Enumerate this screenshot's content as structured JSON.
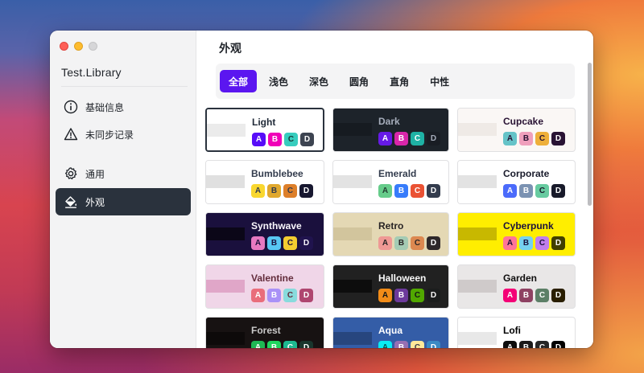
{
  "app": {
    "library_name": "Test.Library"
  },
  "sidebar": {
    "items": [
      {
        "label": "基础信息",
        "icon": "info-icon"
      },
      {
        "label": "未同步记录",
        "icon": "warning-icon"
      },
      {
        "label": "通用",
        "icon": "gear-icon"
      },
      {
        "label": "外观",
        "icon": "paint-bucket-icon"
      }
    ],
    "active_index": 3
  },
  "main": {
    "title": "外观",
    "tabs": [
      "全部",
      "浅色",
      "深色",
      "圆角",
      "直角",
      "中性"
    ],
    "active_tab": 0
  },
  "themes": [
    {
      "name": "Light",
      "bg": "#ffffff",
      "fg": "#1f2937",
      "swatch": "#ffffff",
      "band": "#ebebeb",
      "chips": [
        [
          "A",
          "#570df8",
          "#fff"
        ],
        [
          "B",
          "#f000b8",
          "#fff"
        ],
        [
          "C",
          "#37cdbe",
          "#163835"
        ],
        [
          "D",
          "#3d4451",
          "#fff"
        ]
      ]
    },
    {
      "name": "Dark",
      "bg": "#1d232a",
      "fg": "#a6adbb",
      "swatch": "#1d232a",
      "band": "#161b21",
      "chips": [
        [
          "A",
          "#661ae6",
          "#fff"
        ],
        [
          "B",
          "#d926aa",
          "#fff"
        ],
        [
          "C",
          "#1fb2a5",
          "#fff"
        ],
        [
          "D",
          "#191d24",
          "#a6adbb"
        ]
      ]
    },
    {
      "name": "Cupcake",
      "bg": "#faf7f5",
      "fg": "#291334",
      "swatch": "#faf7f5",
      "band": "#efeae6",
      "chips": [
        [
          "A",
          "#65c3c8",
          "#291334"
        ],
        [
          "B",
          "#ef9fbc",
          "#291334"
        ],
        [
          "C",
          "#eeaf3a",
          "#291334"
        ],
        [
          "D",
          "#291334",
          "#fff"
        ]
      ]
    },
    {
      "name": "Bumblebee",
      "bg": "#ffffff",
      "fg": "#333c4d",
      "swatch": "#ffffff",
      "band": "#e0e0e0",
      "chips": [
        [
          "A",
          "#f9d72f",
          "#333c4d"
        ],
        [
          "B",
          "#e0a82e",
          "#333c4d"
        ],
        [
          "C",
          "#dd7f2a",
          "#333c4d"
        ],
        [
          "D",
          "#181830",
          "#fff"
        ]
      ]
    },
    {
      "name": "Emerald",
      "bg": "#ffffff",
      "fg": "#333c4d",
      "swatch": "#ffffff",
      "band": "#e3e3e3",
      "chips": [
        [
          "A",
          "#66cc8a",
          "#223d30"
        ],
        [
          "B",
          "#377cfb",
          "#fff"
        ],
        [
          "C",
          "#ea5234",
          "#fff"
        ],
        [
          "D",
          "#333c4d",
          "#fff"
        ]
      ]
    },
    {
      "name": "Corporate",
      "bg": "#ffffff",
      "fg": "#181a2a",
      "swatch": "#ffffff",
      "band": "#e3e3e3",
      "chips": [
        [
          "A",
          "#4b6bfb",
          "#fff"
        ],
        [
          "B",
          "#7b92b2",
          "#fff"
        ],
        [
          "C",
          "#67cba0",
          "#181a2a"
        ],
        [
          "D",
          "#181a2a",
          "#fff"
        ]
      ]
    },
    {
      "name": "Synthwave",
      "bg": "#1a103d",
      "fg": "#f9f7fd",
      "swatch": "#1a103d",
      "band": "#0b0718",
      "chips": [
        [
          "A",
          "#e779c1",
          "#1a103d"
        ],
        [
          "B",
          "#58c7f3",
          "#1a103d"
        ],
        [
          "C",
          "#f3cc30",
          "#1a103d"
        ],
        [
          "D",
          "#20134e",
          "#f9f7fd"
        ]
      ]
    },
    {
      "name": "Retro",
      "bg": "#e4d8b4",
      "fg": "#282425",
      "swatch": "#e4d8b4",
      "band": "#d2c59d",
      "chips": [
        [
          "A",
          "#ef9995",
          "#282425"
        ],
        [
          "B",
          "#a4cbb4",
          "#282425"
        ],
        [
          "C",
          "#dc8850",
          "#282425"
        ],
        [
          "D",
          "#2e282a",
          "#fff"
        ]
      ]
    },
    {
      "name": "Cyberpunk",
      "bg": "#ffee00",
      "fg": "#1a103d",
      "swatch": "#ffee00",
      "band": "#c8b800",
      "chips": [
        [
          "A",
          "#ff7598",
          "#1a103d"
        ],
        [
          "B",
          "#75d1f0",
          "#1a103d"
        ],
        [
          "C",
          "#c07eec",
          "#1a103d"
        ],
        [
          "D",
          "#423f00",
          "#fff"
        ]
      ]
    },
    {
      "name": "Valentine",
      "bg": "#f0d6e8",
      "fg": "#632c3b",
      "swatch": "#f0d6e8",
      "band": "#e0a6c8",
      "chips": [
        [
          "A",
          "#e96d7b",
          "#fff"
        ],
        [
          "B",
          "#a991f7",
          "#fff"
        ],
        [
          "C",
          "#88dbdd",
          "#632c3b"
        ],
        [
          "D",
          "#af4670",
          "#fff"
        ]
      ]
    },
    {
      "name": "Halloween",
      "bg": "#212121",
      "fg": "#f8f8f8",
      "swatch": "#212121",
      "band": "#0d0d0d",
      "chips": [
        [
          "A",
          "#f28c18",
          "#131616"
        ],
        [
          "B",
          "#6d3a9c",
          "#fff"
        ],
        [
          "C",
          "#51a800",
          "#131616"
        ],
        [
          "D",
          "#1b1d1d",
          "#f8f8f8"
        ]
      ]
    },
    {
      "name": "Garden",
      "bg": "#e9e7e7",
      "fg": "#100f0f",
      "swatch": "#e9e7e7",
      "band": "#cfcaca",
      "chips": [
        [
          "A",
          "#f40076",
          "#fff"
        ],
        [
          "B",
          "#8e4162",
          "#fff"
        ],
        [
          "C",
          "#5c7f67",
          "#fff"
        ],
        [
          "D",
          "#291e00",
          "#fff"
        ]
      ]
    },
    {
      "name": "Forest",
      "bg": "#171212",
      "fg": "#cac9c9",
      "swatch": "#171212",
      "band": "#0d0a0a",
      "chips": [
        [
          "A",
          "#1eb854",
          "#fff"
        ],
        [
          "B",
          "#1fd65f",
          "#fff"
        ],
        [
          "C",
          "#1db990",
          "#fff"
        ],
        [
          "D",
          "#19362d",
          "#fff"
        ]
      ]
    },
    {
      "name": "Aqua",
      "bg": "#345da7",
      "fg": "#ffffff",
      "swatch": "#345da7",
      "band": "#27467e",
      "chips": [
        [
          "A",
          "#09ecf3",
          "#005355"
        ],
        [
          "B",
          "#966fb3",
          "#fff"
        ],
        [
          "C",
          "#ffe999",
          "#333c4d"
        ],
        [
          "D",
          "#3b8ac4",
          "#fff"
        ]
      ]
    },
    {
      "name": "Lofi",
      "bg": "#ffffff",
      "fg": "#000000",
      "swatch": "#ffffff",
      "band": "#e8e8e8",
      "chips": [
        [
          "A",
          "#0d0d0d",
          "#fff"
        ],
        [
          "B",
          "#1a1919",
          "#fff"
        ],
        [
          "C",
          "#262626",
          "#fff"
        ],
        [
          "D",
          "#000000",
          "#fff"
        ]
      ]
    }
  ],
  "selected_theme": 0
}
